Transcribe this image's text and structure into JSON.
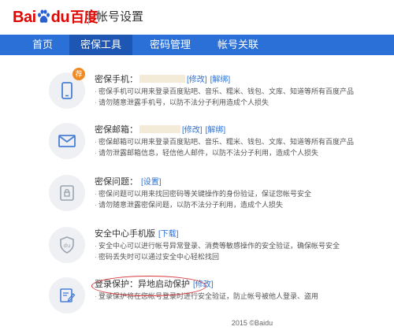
{
  "header": {
    "logo": {
      "bai": "Bai",
      "du": "du",
      "cn": "百度"
    },
    "title": "帐号设置"
  },
  "nav": {
    "tabs": [
      {
        "label": "首页",
        "active": false
      },
      {
        "label": "密保工具",
        "active": true
      },
      {
        "label": "密码管理",
        "active": false
      },
      {
        "label": "帐号关联",
        "active": false
      }
    ]
  },
  "items": [
    {
      "icon": "phone-icon",
      "badge": "荐",
      "title": "密保手机：",
      "links": [
        "[修改]",
        "[解绑]"
      ],
      "desc": [
        "密保手机可以用来登录百度贴吧、音乐、糯米、钱包、文库、知道等所有百度产品",
        "请勿随意泄露手机号，以防不法分子利用造成个人损失"
      ]
    },
    {
      "icon": "mail-icon",
      "title": "密保邮箱：",
      "links": [
        "[修改]",
        "[解绑]"
      ],
      "desc": [
        "密保邮箱可以用来登录百度贴吧、音乐、糯米、钱包、文库、知道等所有百度产品",
        "请勿泄露邮箱信息，轻信他人邮件，以防不法分子利用，造成个人损失"
      ]
    },
    {
      "icon": "lock-icon",
      "title": "密保问题：",
      "links": [
        "[设置]"
      ],
      "desc": [
        "密保问题可以用来找回密码等关键操作的身份验证，保证您帐号安全",
        "请勿随意泄露密保问题，以防不法分子利用，造成个人损失"
      ]
    },
    {
      "icon": "shield-du-icon",
      "title": "安全中心手机版",
      "links": [
        "[下载]"
      ],
      "desc": [
        "安全中心可以进行帐号异常登录、消费等敏感操作的安全验证，确保帐号安全",
        "密码丢失时可以通过安全中心轻松找回"
      ]
    },
    {
      "icon": "edit-icon",
      "title": "登录保护：异地启动保护",
      "links": [
        "[修改]"
      ],
      "desc": [
        "登录保护将在您帐号登录时进行安全验证，防止帐号被他人登录、盗用"
      ]
    }
  ],
  "footer": "2015 ©Baidu",
  "colors": {
    "brand_red": "#e10602",
    "nav_blue": "#2b70d6",
    "link_blue": "#2b70d6",
    "badge_orange": "#f08a24",
    "highlight_red": "#d9343b"
  }
}
